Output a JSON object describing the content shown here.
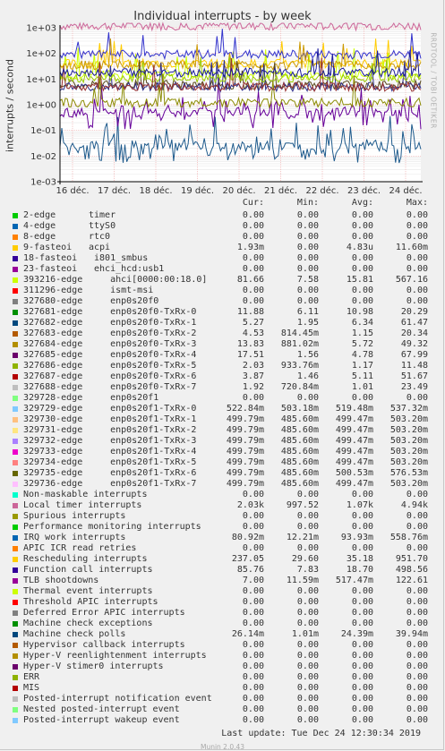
{
  "title": "Individual interrupts - by week",
  "ylabel": "interrupts / second",
  "side_credit": "RRDTOOL / TOBI OETIKER",
  "legend_headers": {
    "cur": "Cur:",
    "min": "Min:",
    "avg": "Avg:",
    "max": "Max:"
  },
  "chart_data": {
    "type": "line",
    "title": "Individual interrupts - by week",
    "ylabel": "interrupts / second",
    "yscale": "log",
    "ylim": [
      0.001,
      1000
    ],
    "y_ticks": [
      "1e-03",
      "1e-02",
      "1e-01",
      "1e+00",
      "1e+01",
      "1e+02",
      "1e+03"
    ],
    "x_ticks": [
      "16 déc.",
      "17 déc.",
      "18 déc.",
      "19 déc.",
      "20 déc.",
      "21 déc.",
      "22 déc.",
      "23 déc.",
      "24 déc."
    ],
    "grid": true,
    "series": [
      {
        "name": "Local timer interrupts",
        "color": "#cc6699",
        "level": 1200
      },
      {
        "name": "329729-edge",
        "color": "#ffcc00",
        "level": 40
      },
      {
        "name": "ahci[0000:00:18.0]",
        "color": "#ccff00",
        "level": 15
      },
      {
        "name": "Machine check polls",
        "color": "#1e5a8c",
        "level": 0.025
      },
      {
        "name": "IRQ work interrupts",
        "color": "#3333cc",
        "level": 90
      },
      {
        "name": "TLB shootdowns",
        "color": "#660099",
        "level": 0.5
      },
      {
        "name": "Rescheduling interrupts",
        "color": "#cc9900",
        "level": 35
      },
      {
        "name": "enp0s20f0-TxRx-1",
        "color": "#5b4b1f",
        "level": 6
      },
      {
        "name": "enp0s20f0-TxRx-4",
        "color": "#2d2d8a",
        "level": 5
      },
      {
        "name": "enp0s20f0-TxRx-0",
        "color": "#99cc00",
        "level": 11
      },
      {
        "name": "enp0s20f0-TxRx-5",
        "color": "#8a8a00",
        "level": 1.2
      },
      {
        "name": "enp0s20f0-TxRx-6",
        "color": "#993333",
        "level": 5
      },
      {
        "name": "Function call interrupts",
        "color": "#1a1a99",
        "level": 18
      }
    ]
  },
  "legend": [
    {
      "color": "#00cc00",
      "name": "2-edge",
      "name2": "timer",
      "cur": "0.00",
      "min": "0.00",
      "avg": "0.00",
      "max": "0.00"
    },
    {
      "color": "#0066b3",
      "name": "4-edge",
      "name2": "ttyS0",
      "cur": "0.00",
      "min": "0.00",
      "avg": "0.00",
      "max": "0.00"
    },
    {
      "color": "#ff8000",
      "name": "8-edge",
      "name2": "rtc0",
      "cur": "0.00",
      "min": "0.00",
      "avg": "0.00",
      "max": "0.00"
    },
    {
      "color": "#ffcc00",
      "name": "9-fasteoi",
      "name2": "acpi",
      "cur": "1.93m",
      "min": "0.00",
      "avg": "4.83u",
      "max": "11.60m"
    },
    {
      "color": "#330099",
      "name": "18-fasteoi",
      "name2": " i801_smbus",
      "cur": "0.00",
      "min": "0.00",
      "avg": "0.00",
      "max": "0.00"
    },
    {
      "color": "#990099",
      "name": "23-fasteoi",
      "name2": " ehci_hcd:usb1",
      "cur": "0.00",
      "min": "0.00",
      "avg": "0.00",
      "max": "0.00"
    },
    {
      "color": "#ccff00",
      "name": "393216-edge",
      "name2": "    ahci[0000:00:18.0]",
      "cur": "81.66",
      "min": "7.58",
      "avg": "15.81",
      "max": "567.16"
    },
    {
      "color": "#ff0000",
      "name": "311296-edge",
      "name2": "    ismt-msi",
      "cur": "0.00",
      "min": "0.00",
      "avg": "0.00",
      "max": "0.00"
    },
    {
      "color": "#808080",
      "name": "327680-edge",
      "name2": "    enp0s20f0",
      "cur": "0.00",
      "min": "0.00",
      "avg": "0.00",
      "max": "0.00"
    },
    {
      "color": "#008f00",
      "name": "327681-edge",
      "name2": "    enp0s20f0-TxRx-0",
      "cur": "11.88",
      "min": "6.11",
      "avg": "10.98",
      "max": "20.29"
    },
    {
      "color": "#00487d",
      "name": "327682-edge",
      "name2": "    enp0s20f0-TxRx-1",
      "cur": "5.27",
      "min": "1.95",
      "avg": "6.34",
      "max": "61.47"
    },
    {
      "color": "#b35a00",
      "name": "327683-edge",
      "name2": "    enp0s20f0-TxRx-2",
      "cur": "4.53",
      "min": "814.45m",
      "avg": "1.15",
      "max": "20.34"
    },
    {
      "color": "#b38f00",
      "name": "327684-edge",
      "name2": "    enp0s20f0-TxRx-3",
      "cur": "13.83",
      "min": "881.02m",
      "avg": "5.72",
      "max": "49.32"
    },
    {
      "color": "#6b006b",
      "name": "327685-edge",
      "name2": "    enp0s20f0-TxRx-4",
      "cur": "17.51",
      "min": "1.56",
      "avg": "4.78",
      "max": "67.99"
    },
    {
      "color": "#8fb300",
      "name": "327686-edge",
      "name2": "    enp0s20f0-TxRx-5",
      "cur": "2.03",
      "min": "933.76m",
      "avg": "1.17",
      "max": "11.48"
    },
    {
      "color": "#b30000",
      "name": "327687-edge",
      "name2": "    enp0s20f0-TxRx-6",
      "cur": "3.87",
      "min": "1.46",
      "avg": "5.11",
      "max": "51.67"
    },
    {
      "color": "#bebebe",
      "name": "327688-edge",
      "name2": "    enp0s20f0-TxRx-7",
      "cur": "1.92",
      "min": "720.84m",
      "avg": "1.01",
      "max": "23.49"
    },
    {
      "color": "#80ff80",
      "name": "329728-edge",
      "name2": "    enp0s20f1",
      "cur": "0.00",
      "min": "0.00",
      "avg": "0.00",
      "max": "0.00"
    },
    {
      "color": "#80c9ff",
      "name": "329729-edge",
      "name2": "    enp0s20f1-TxRx-0",
      "cur": "522.84m",
      "min": "503.18m",
      "avg": "519.48m",
      "max": "537.32m"
    },
    {
      "color": "#ffc080",
      "name": "329730-edge",
      "name2": "    enp0s20f1-TxRx-1",
      "cur": "499.79m",
      "min": "485.60m",
      "avg": "499.47m",
      "max": "503.20m"
    },
    {
      "color": "#ffe680",
      "name": "329731-edge",
      "name2": "    enp0s20f1-TxRx-2",
      "cur": "499.79m",
      "min": "485.60m",
      "avg": "499.47m",
      "max": "503.20m"
    },
    {
      "color": "#aa80ff",
      "name": "329732-edge",
      "name2": "    enp0s20f1-TxRx-3",
      "cur": "499.79m",
      "min": "485.60m",
      "avg": "499.47m",
      "max": "503.20m"
    },
    {
      "color": "#ee00cc",
      "name": "329733-edge",
      "name2": "    enp0s20f1-TxRx-4",
      "cur": "499.79m",
      "min": "485.60m",
      "avg": "499.47m",
      "max": "503.20m"
    },
    {
      "color": "#ff8080",
      "name": "329734-edge",
      "name2": "    enp0s20f1-TxRx-5",
      "cur": "499.79m",
      "min": "485.60m",
      "avg": "499.47m",
      "max": "503.20m"
    },
    {
      "color": "#666600",
      "name": "329735-edge",
      "name2": "    enp0s20f1-TxRx-6",
      "cur": "499.79m",
      "min": "485.60m",
      "avg": "500.53m",
      "max": "576.53m"
    },
    {
      "color": "#ffbfff",
      "name": "329736-edge",
      "name2": "    enp0s20f1-TxRx-7",
      "cur": "499.79m",
      "min": "485.60m",
      "avg": "499.47m",
      "max": "503.20m"
    },
    {
      "color": "#00ffcc",
      "name": "Non-maskable interrupts",
      "name2": "",
      "cur": "0.00",
      "min": "0.00",
      "avg": "0.00",
      "max": "0.00"
    },
    {
      "color": "#cc6699",
      "name": "Local timer interrupts",
      "name2": "",
      "cur": "2.03k",
      "min": "997.52",
      "avg": "1.07k",
      "max": "4.94k"
    },
    {
      "color": "#999900",
      "name": "Spurious interrupts",
      "name2": "",
      "cur": "0.00",
      "min": "0.00",
      "avg": "0.00",
      "max": "0.00"
    },
    {
      "color": "#00cc00",
      "name": "Performance monitoring interrupts",
      "name2": "",
      "cur": "0.00",
      "min": "0.00",
      "avg": "0.00",
      "max": "0.00"
    },
    {
      "color": "#0066b3",
      "name": "IRQ work interrupts",
      "name2": "",
      "cur": "80.92m",
      "min": "12.21m",
      "avg": "93.93m",
      "max": "558.76m"
    },
    {
      "color": "#ff8000",
      "name": "APIC ICR read retries",
      "name2": "",
      "cur": "0.00",
      "min": "0.00",
      "avg": "0.00",
      "max": "0.00"
    },
    {
      "color": "#ffcc00",
      "name": "Rescheduling interrupts",
      "name2": "",
      "cur": "237.05",
      "min": "29.60",
      "avg": "35.18",
      "max": "951.70"
    },
    {
      "color": "#330099",
      "name": "Function call interrupts",
      "name2": "",
      "cur": "85.76",
      "min": "7.83",
      "avg": "18.70",
      "max": "498.56"
    },
    {
      "color": "#990099",
      "name": "TLB shootdowns",
      "name2": "",
      "cur": "7.00",
      "min": "11.59m",
      "avg": "517.47m",
      "max": "122.61"
    },
    {
      "color": "#ccff00",
      "name": "Thermal event interrupts",
      "name2": "",
      "cur": "0.00",
      "min": "0.00",
      "avg": "0.00",
      "max": "0.00"
    },
    {
      "color": "#ff0000",
      "name": "Threshold APIC interrupts",
      "name2": "",
      "cur": "0.00",
      "min": "0.00",
      "avg": "0.00",
      "max": "0.00"
    },
    {
      "color": "#808080",
      "name": "Deferred Error APIC interrupts",
      "name2": "",
      "cur": "0.00",
      "min": "0.00",
      "avg": "0.00",
      "max": "0.00"
    },
    {
      "color": "#008f00",
      "name": "Machine check exceptions",
      "name2": "",
      "cur": "0.00",
      "min": "0.00",
      "avg": "0.00",
      "max": "0.00"
    },
    {
      "color": "#00487d",
      "name": "Machine check polls",
      "name2": "",
      "cur": "26.14m",
      "min": "1.01m",
      "avg": "24.39m",
      "max": "39.94m"
    },
    {
      "color": "#b35a00",
      "name": "Hypervisor callback interrupts",
      "name2": "",
      "cur": "0.00",
      "min": "0.00",
      "avg": "0.00",
      "max": "0.00"
    },
    {
      "color": "#b38f00",
      "name": "Hyper-V reenlightenment interrupts",
      "name2": "",
      "cur": "0.00",
      "min": "0.00",
      "avg": "0.00",
      "max": "0.00"
    },
    {
      "color": "#6b006b",
      "name": "Hyper-V stimer0 interrupts",
      "name2": "",
      "cur": "0.00",
      "min": "0.00",
      "avg": "0.00",
      "max": "0.00"
    },
    {
      "color": "#8fb300",
      "name": "ERR",
      "name2": "",
      "cur": "0.00",
      "min": "0.00",
      "avg": "0.00",
      "max": "0.00"
    },
    {
      "color": "#b30000",
      "name": "MIS",
      "name2": "",
      "cur": "0.00",
      "min": "0.00",
      "avg": "0.00",
      "max": "0.00"
    },
    {
      "color": "#bebebe",
      "name": "Posted-interrupt notification event",
      "name2": "",
      "cur": "0.00",
      "min": "0.00",
      "avg": "0.00",
      "max": "0.00"
    },
    {
      "color": "#80ff80",
      "name": "Nested posted-interrupt event",
      "name2": "",
      "cur": "0.00",
      "min": "0.00",
      "avg": "0.00",
      "max": "0.00"
    },
    {
      "color": "#80c9ff",
      "name": "Posted-interrupt wakeup event",
      "name2": "",
      "cur": "0.00",
      "min": "0.00",
      "avg": "0.00",
      "max": "0.00"
    }
  ],
  "last_update": "Last update: Tue Dec 24 12:30:34 2019",
  "munin_version": "Munin 2.0.43"
}
